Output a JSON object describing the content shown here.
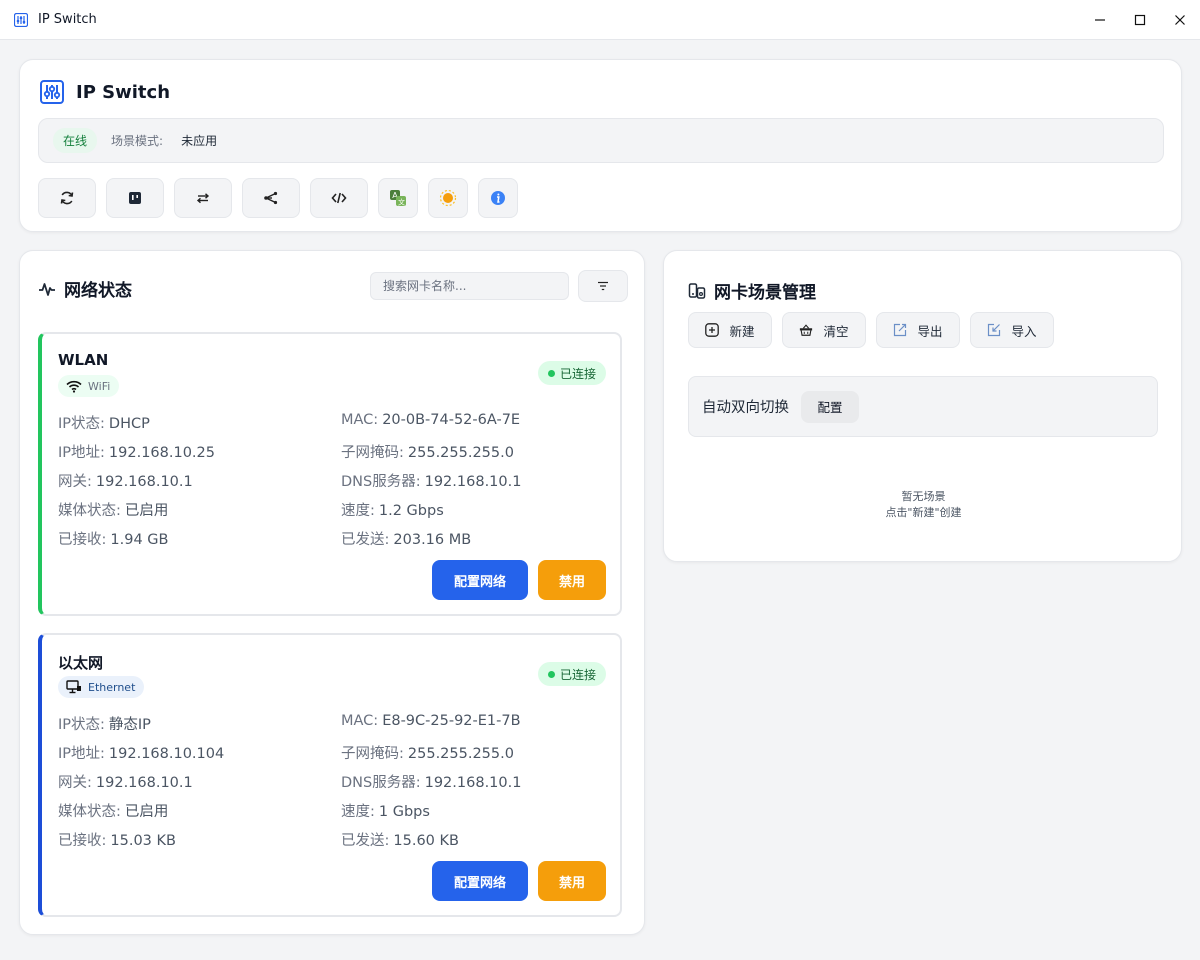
{
  "window": {
    "title": "IP Switch"
  },
  "header": {
    "title": "IP Switch",
    "status_badge": "在线",
    "scene_label": "场景模式:",
    "scene_value": "未应用",
    "tools": [
      {
        "icon": "refresh-icon"
      },
      {
        "icon": "terminal-icon"
      },
      {
        "icon": "swap-icon"
      },
      {
        "icon": "network-share-icon"
      },
      {
        "icon": "code-icon"
      },
      {
        "icon": "translate-icon"
      },
      {
        "icon": "sun-theme-icon"
      },
      {
        "icon": "info-icon"
      }
    ]
  },
  "network": {
    "title": "网络状态",
    "search_placeholder": "搜索网卡名称...",
    "adapters": [
      {
        "name": "WLAN",
        "type": "WiFi",
        "status": "已连接",
        "ip_status_label": "IP状态:",
        "ip_status": "DHCP",
        "mac_label": "MAC:",
        "mac": "20-0B-74-52-6A-7E",
        "ip_label": "IP地址:",
        "ip": "192.168.10.25",
        "mask_label": "子网掩码:",
        "mask": "255.255.255.0",
        "gateway_label": "网关:",
        "gateway": "192.168.10.1",
        "dns_label": "DNS服务器:",
        "dns": "192.168.10.1",
        "media_label": "媒体状态:",
        "media": "已启用",
        "speed_label": "速度:",
        "speed": "1.2 Gbps",
        "received_label": "已接收:",
        "received": "1.94 GB",
        "sent_label": "已发送:",
        "sent": "203.16 MB",
        "config_label": "配置网络",
        "disable_label": "禁用"
      },
      {
        "name": "以太网",
        "type": "Ethernet",
        "status": "已连接",
        "ip_status_label": "IP状态:",
        "ip_status": "静态IP",
        "mac_label": "MAC:",
        "mac": "E8-9C-25-92-E1-7B",
        "ip_label": "IP地址:",
        "ip": "192.168.10.104",
        "mask_label": "子网掩码:",
        "mask": "255.255.255.0",
        "gateway_label": "网关:",
        "gateway": "192.168.10.1",
        "dns_label": "DNS服务器:",
        "dns": "192.168.10.1",
        "media_label": "媒体状态:",
        "media": "已启用",
        "speed_label": "速度:",
        "speed": "1 Gbps",
        "received_label": "已接收:",
        "received": "15.03 KB",
        "sent_label": "已发送:",
        "sent": "15.60 KB",
        "config_label": "配置网络",
        "disable_label": "禁用"
      }
    ]
  },
  "scenes": {
    "title": "网卡场景管理",
    "new_label": "新建",
    "clear_label": "清空",
    "export_label": "导出",
    "import_label": "导入",
    "auto_switch_label": "自动双向切换",
    "auto_switch_config": "配置",
    "empty_line1": "暂无场景",
    "empty_line2": "点击\"新建\"创建"
  },
  "colors": {
    "primary": "#2563eb",
    "warning": "#f59e0b",
    "success": "#22c55e",
    "ethernet_accent": "#1d4ed8"
  }
}
